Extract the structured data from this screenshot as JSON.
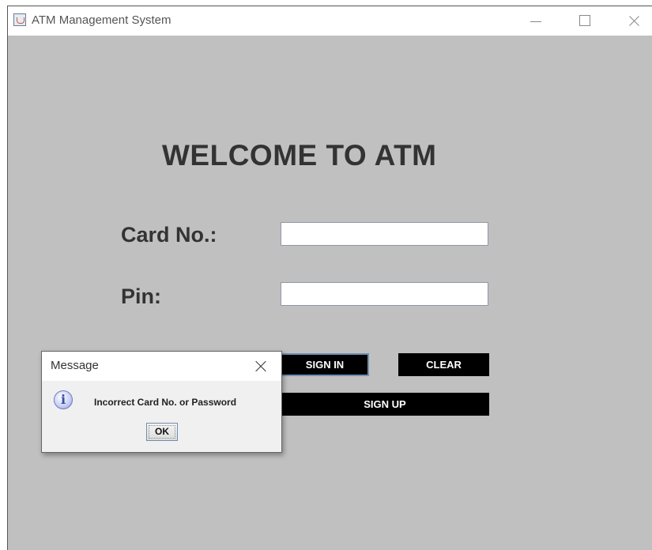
{
  "window": {
    "title": "ATM Management System",
    "app_icon": "java-cup-icon",
    "controls": [
      "minimize-icon",
      "maximize-icon",
      "close-icon"
    ]
  },
  "main": {
    "heading": "WELCOME TO ATM",
    "card_label": "Card No.:",
    "card_value": "",
    "pin_label": "Pin:",
    "pin_value": "",
    "signin_label": "SIGN IN",
    "clear_label": "CLEAR",
    "signup_label": "SIGN UP"
  },
  "dialog": {
    "title": "Message",
    "icon": "info-icon",
    "message": "Incorrect Card No. or Password",
    "ok_label": "OK"
  },
  "colors": {
    "background": "#c0c0c0",
    "button": "#000000",
    "button_text": "#ffffff",
    "heading": "#333333"
  }
}
